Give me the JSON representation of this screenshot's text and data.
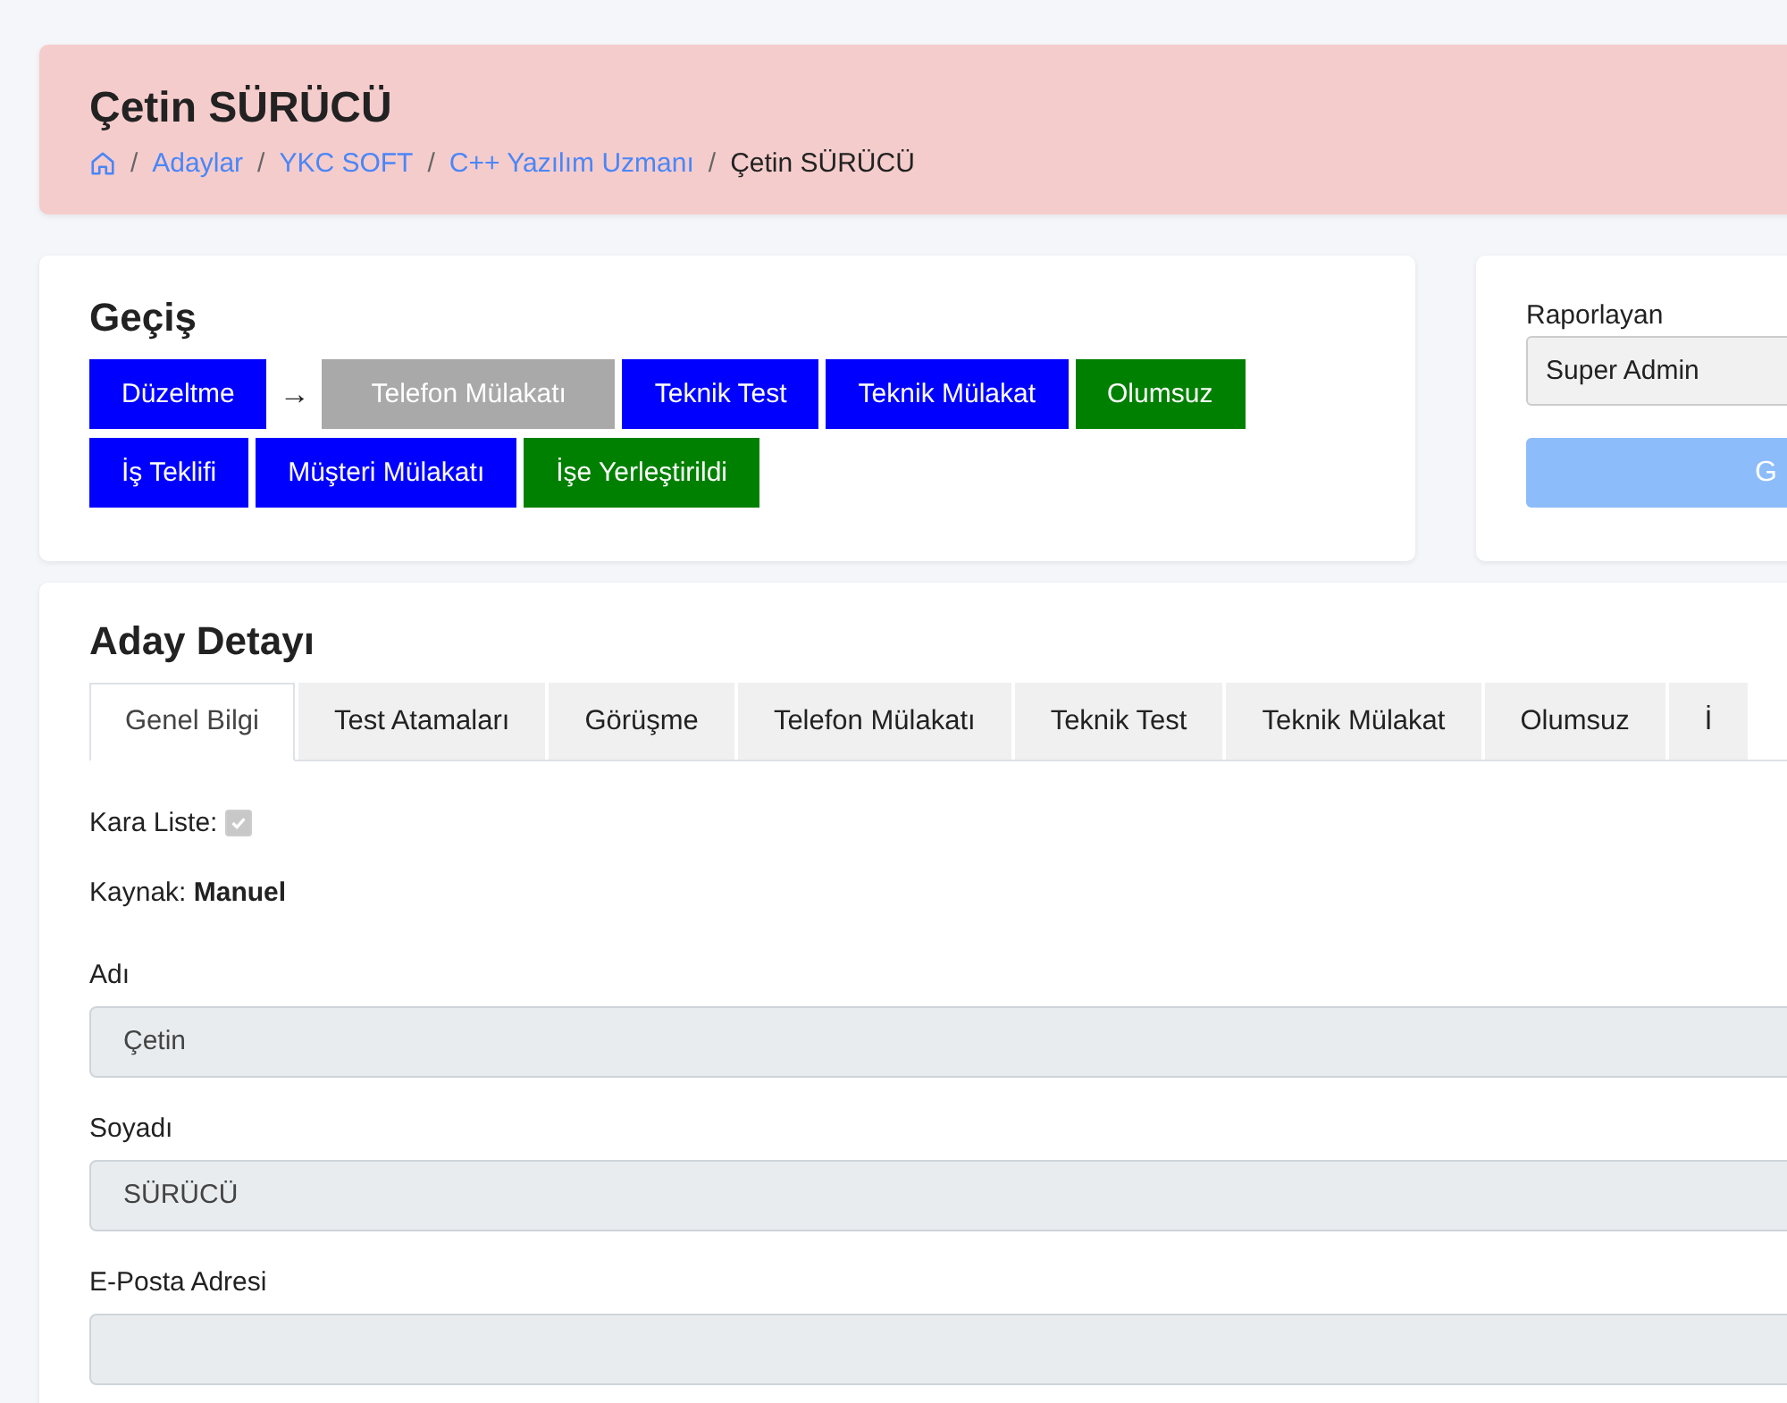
{
  "header": {
    "title": "Çetin SÜRÜCÜ",
    "breadcrumb": [
      {
        "label": "Adaylar"
      },
      {
        "label": "YKC SOFT"
      },
      {
        "label": "C++ Yazılım Uzmanı"
      }
    ],
    "current": "Çetin SÜRÜCÜ",
    "separator": "/"
  },
  "transition": {
    "title": "Geçiş",
    "arrow": "→",
    "buttons": [
      {
        "label": "Düzeltme",
        "kind": "primary"
      },
      {
        "label": "Telefon Mülakatı",
        "kind": "disabled"
      },
      {
        "label": "Teknik Test",
        "kind": "primary"
      },
      {
        "label": "Teknik Mülakat",
        "kind": "primary"
      },
      {
        "label": "Olumsuz",
        "kind": "success"
      },
      {
        "label": "İş Teklifi",
        "kind": "primary"
      },
      {
        "label": "Müşteri Mülakatı",
        "kind": "primary"
      },
      {
        "label": "İşe Yerleştirildi",
        "kind": "success"
      }
    ]
  },
  "report": {
    "label": "Raporlayan",
    "value": "Super Admin",
    "button": "G"
  },
  "detail": {
    "title": "Aday Detayı",
    "tabs": [
      {
        "label": "Genel Bilgi",
        "selected": true
      },
      {
        "label": "Test Atamaları",
        "selected": false
      },
      {
        "label": "Görüşme",
        "selected": false
      },
      {
        "label": "Telefon Mülakatı",
        "selected": false
      },
      {
        "label": "Teknik Test",
        "selected": false
      },
      {
        "label": "Teknik Mülakat",
        "selected": false
      },
      {
        "label": "Olumsuz",
        "selected": false
      },
      {
        "label": "İ",
        "selected": false
      }
    ],
    "blacklist": {
      "label": "Kara Liste:",
      "checked": true
    },
    "source": {
      "label": "Kaynak:",
      "value": "Manuel"
    },
    "fields": [
      {
        "label": "Adı",
        "value": "Çetin"
      },
      {
        "label": "Soyadı",
        "value": "SÜRÜCÜ"
      },
      {
        "label": "E-Posta Adresi"
      }
    ]
  }
}
